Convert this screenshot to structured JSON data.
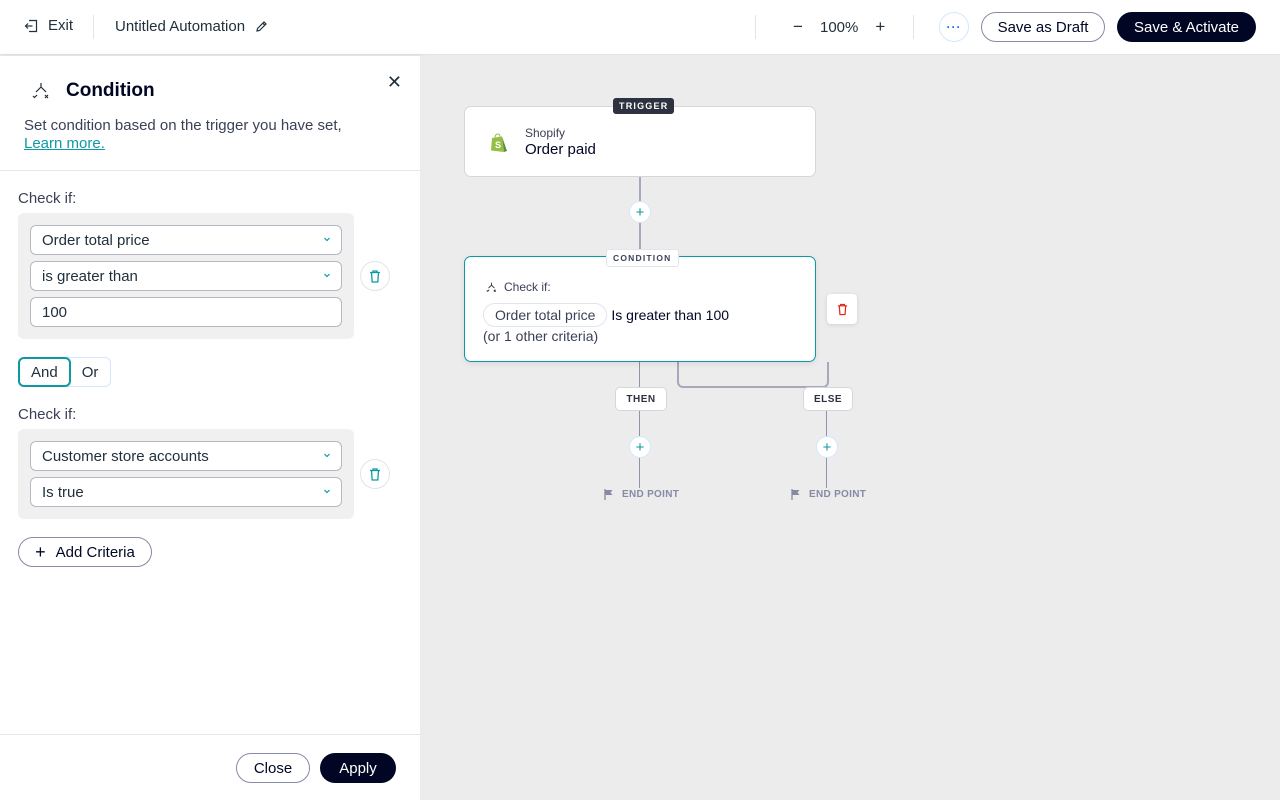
{
  "topbar": {
    "exit_label": "Exit",
    "automation_title": "Untitled Automation",
    "zoom_out": "−",
    "zoom_level": "100%",
    "zoom_in": "+",
    "more_label": "···",
    "save_draft_label": "Save as Draft",
    "save_activate_label": "Save & Activate"
  },
  "panel": {
    "title": "Condition",
    "close_glyph": "✕",
    "description": "Set condition based on the trigger you have set,",
    "learn_more": "Learn more.",
    "criteria": [
      {
        "label": "Check if:",
        "field": "Order total price",
        "operator": "is greater than",
        "value": "100"
      },
      {
        "label": "Check if:",
        "field": "Customer store accounts",
        "operator": "Is true"
      }
    ],
    "logic": {
      "and": "And",
      "or": "Or",
      "selected": "And"
    },
    "add_criteria": "Add Criteria",
    "add_glyph": "+",
    "footer": {
      "close": "Close",
      "apply": "Apply"
    }
  },
  "canvas": {
    "trigger": {
      "tag": "TRIGGER",
      "app": "Shopify",
      "event": "Order paid"
    },
    "condition": {
      "tag": "CONDITION",
      "check_label": "Check if:",
      "field_chip": "Order total price",
      "operator_text": "Is greater than",
      "value": "100",
      "other": "(or 1 other criteria)"
    },
    "branches": {
      "then": "THEN",
      "else": "ELSE",
      "end_point": "END POINT"
    },
    "plus_glyph": "+",
    "colors": {
      "accent": "#0b9aa5",
      "primary_dark": "#000624",
      "delete_red": "#e62214",
      "shopify_green": "#95bf47"
    }
  }
}
